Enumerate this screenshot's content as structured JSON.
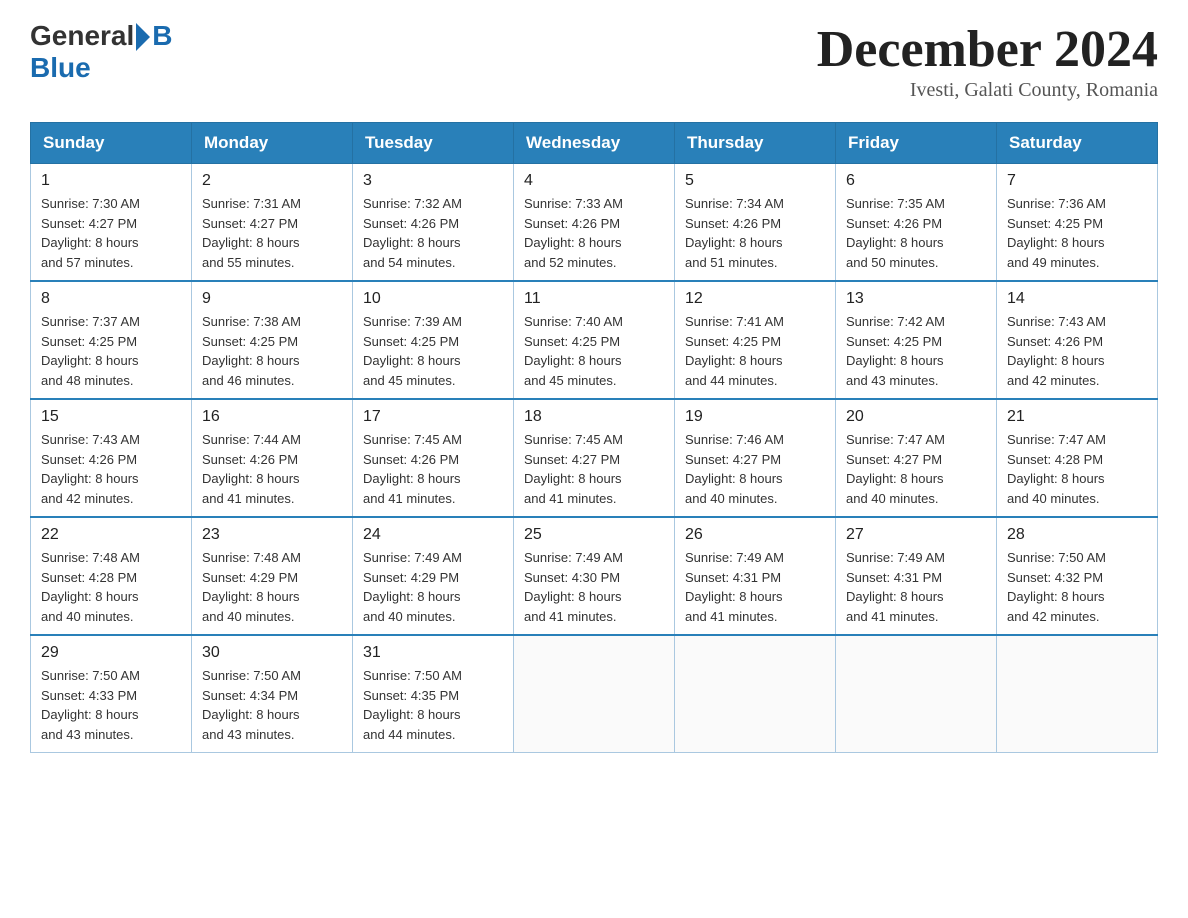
{
  "logo": {
    "general": "General",
    "blue": "Blue"
  },
  "title": "December 2024",
  "location": "Ivesti, Galati County, Romania",
  "weekdays": [
    "Sunday",
    "Monday",
    "Tuesday",
    "Wednesday",
    "Thursday",
    "Friday",
    "Saturday"
  ],
  "weeks": [
    [
      {
        "day": "1",
        "info": "Sunrise: 7:30 AM\nSunset: 4:27 PM\nDaylight: 8 hours\nand 57 minutes."
      },
      {
        "day": "2",
        "info": "Sunrise: 7:31 AM\nSunset: 4:27 PM\nDaylight: 8 hours\nand 55 minutes."
      },
      {
        "day": "3",
        "info": "Sunrise: 7:32 AM\nSunset: 4:26 PM\nDaylight: 8 hours\nand 54 minutes."
      },
      {
        "day": "4",
        "info": "Sunrise: 7:33 AM\nSunset: 4:26 PM\nDaylight: 8 hours\nand 52 minutes."
      },
      {
        "day": "5",
        "info": "Sunrise: 7:34 AM\nSunset: 4:26 PM\nDaylight: 8 hours\nand 51 minutes."
      },
      {
        "day": "6",
        "info": "Sunrise: 7:35 AM\nSunset: 4:26 PM\nDaylight: 8 hours\nand 50 minutes."
      },
      {
        "day": "7",
        "info": "Sunrise: 7:36 AM\nSunset: 4:25 PM\nDaylight: 8 hours\nand 49 minutes."
      }
    ],
    [
      {
        "day": "8",
        "info": "Sunrise: 7:37 AM\nSunset: 4:25 PM\nDaylight: 8 hours\nand 48 minutes."
      },
      {
        "day": "9",
        "info": "Sunrise: 7:38 AM\nSunset: 4:25 PM\nDaylight: 8 hours\nand 46 minutes."
      },
      {
        "day": "10",
        "info": "Sunrise: 7:39 AM\nSunset: 4:25 PM\nDaylight: 8 hours\nand 45 minutes."
      },
      {
        "day": "11",
        "info": "Sunrise: 7:40 AM\nSunset: 4:25 PM\nDaylight: 8 hours\nand 45 minutes."
      },
      {
        "day": "12",
        "info": "Sunrise: 7:41 AM\nSunset: 4:25 PM\nDaylight: 8 hours\nand 44 minutes."
      },
      {
        "day": "13",
        "info": "Sunrise: 7:42 AM\nSunset: 4:25 PM\nDaylight: 8 hours\nand 43 minutes."
      },
      {
        "day": "14",
        "info": "Sunrise: 7:43 AM\nSunset: 4:26 PM\nDaylight: 8 hours\nand 42 minutes."
      }
    ],
    [
      {
        "day": "15",
        "info": "Sunrise: 7:43 AM\nSunset: 4:26 PM\nDaylight: 8 hours\nand 42 minutes."
      },
      {
        "day": "16",
        "info": "Sunrise: 7:44 AM\nSunset: 4:26 PM\nDaylight: 8 hours\nand 41 minutes."
      },
      {
        "day": "17",
        "info": "Sunrise: 7:45 AM\nSunset: 4:26 PM\nDaylight: 8 hours\nand 41 minutes."
      },
      {
        "day": "18",
        "info": "Sunrise: 7:45 AM\nSunset: 4:27 PM\nDaylight: 8 hours\nand 41 minutes."
      },
      {
        "day": "19",
        "info": "Sunrise: 7:46 AM\nSunset: 4:27 PM\nDaylight: 8 hours\nand 40 minutes."
      },
      {
        "day": "20",
        "info": "Sunrise: 7:47 AM\nSunset: 4:27 PM\nDaylight: 8 hours\nand 40 minutes."
      },
      {
        "day": "21",
        "info": "Sunrise: 7:47 AM\nSunset: 4:28 PM\nDaylight: 8 hours\nand 40 minutes."
      }
    ],
    [
      {
        "day": "22",
        "info": "Sunrise: 7:48 AM\nSunset: 4:28 PM\nDaylight: 8 hours\nand 40 minutes."
      },
      {
        "day": "23",
        "info": "Sunrise: 7:48 AM\nSunset: 4:29 PM\nDaylight: 8 hours\nand 40 minutes."
      },
      {
        "day": "24",
        "info": "Sunrise: 7:49 AM\nSunset: 4:29 PM\nDaylight: 8 hours\nand 40 minutes."
      },
      {
        "day": "25",
        "info": "Sunrise: 7:49 AM\nSunset: 4:30 PM\nDaylight: 8 hours\nand 41 minutes."
      },
      {
        "day": "26",
        "info": "Sunrise: 7:49 AM\nSunset: 4:31 PM\nDaylight: 8 hours\nand 41 minutes."
      },
      {
        "day": "27",
        "info": "Sunrise: 7:49 AM\nSunset: 4:31 PM\nDaylight: 8 hours\nand 41 minutes."
      },
      {
        "day": "28",
        "info": "Sunrise: 7:50 AM\nSunset: 4:32 PM\nDaylight: 8 hours\nand 42 minutes."
      }
    ],
    [
      {
        "day": "29",
        "info": "Sunrise: 7:50 AM\nSunset: 4:33 PM\nDaylight: 8 hours\nand 43 minutes."
      },
      {
        "day": "30",
        "info": "Sunrise: 7:50 AM\nSunset: 4:34 PM\nDaylight: 8 hours\nand 43 minutes."
      },
      {
        "day": "31",
        "info": "Sunrise: 7:50 AM\nSunset: 4:35 PM\nDaylight: 8 hours\nand 44 minutes."
      },
      {
        "day": "",
        "info": ""
      },
      {
        "day": "",
        "info": ""
      },
      {
        "day": "",
        "info": ""
      },
      {
        "day": "",
        "info": ""
      }
    ]
  ]
}
